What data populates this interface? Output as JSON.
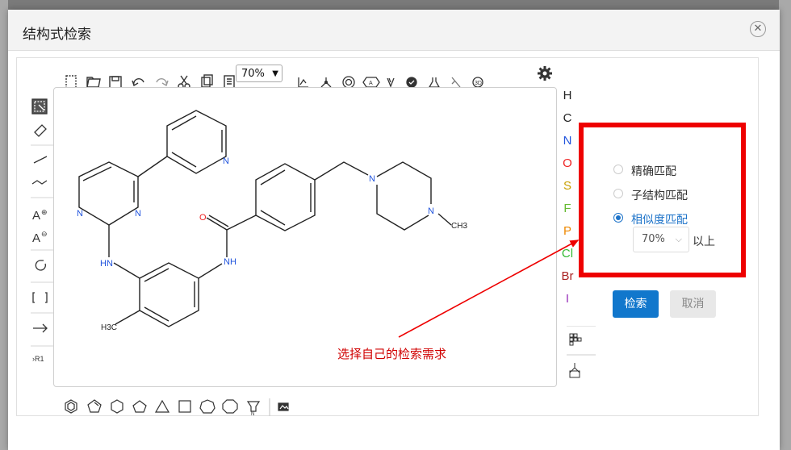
{
  "dialog": {
    "title": "结构式检索",
    "close_icon": "close-icon"
  },
  "toolbar": {
    "zoom_value": "70%"
  },
  "atoms": [
    {
      "symbol": "H",
      "color": "#222222"
    },
    {
      "symbol": "C",
      "color": "#222222"
    },
    {
      "symbol": "N",
      "color": "#2255dd"
    },
    {
      "symbol": "O",
      "color": "#ee2222"
    },
    {
      "symbol": "S",
      "color": "#c8a000"
    },
    {
      "symbol": "F",
      "color": "#66bb33"
    },
    {
      "symbol": "P",
      "color": "#ee8800"
    },
    {
      "symbol": "Cl",
      "color": "#33bb33"
    },
    {
      "symbol": "Br",
      "color": "#aa2222"
    },
    {
      "symbol": "I",
      "color": "#9933bb"
    }
  ],
  "left_tools": {
    "r1_label": "R1",
    "bracket_label": "[ ]"
  },
  "molecule": {
    "labels": {
      "n_pyridine": "N",
      "n_pyrimidine_1": "N",
      "n_pyrimidine_2": "N",
      "nh_amine": "HN",
      "h3c_methyl": "H3C",
      "o_carbonyl": "O",
      "nh_amide": "NH",
      "n_piperazine_1": "N",
      "n_piperazine_2": "N",
      "ch3_methyl": "CH3"
    }
  },
  "search_options": {
    "options": [
      {
        "label": "精确匹配",
        "selected": false
      },
      {
        "label": "子结构匹配",
        "selected": false
      },
      {
        "label": "相似度匹配",
        "selected": true
      }
    ],
    "similarity_value": "70%",
    "above_label": "以上"
  },
  "buttons": {
    "search_label": "检索",
    "cancel_label": "取消"
  },
  "annotation": {
    "text": "选择自己的检索需求",
    "color": "#dd0000"
  },
  "colors": {
    "accent": "#1177cc",
    "highlight_box": "#ee0000"
  }
}
